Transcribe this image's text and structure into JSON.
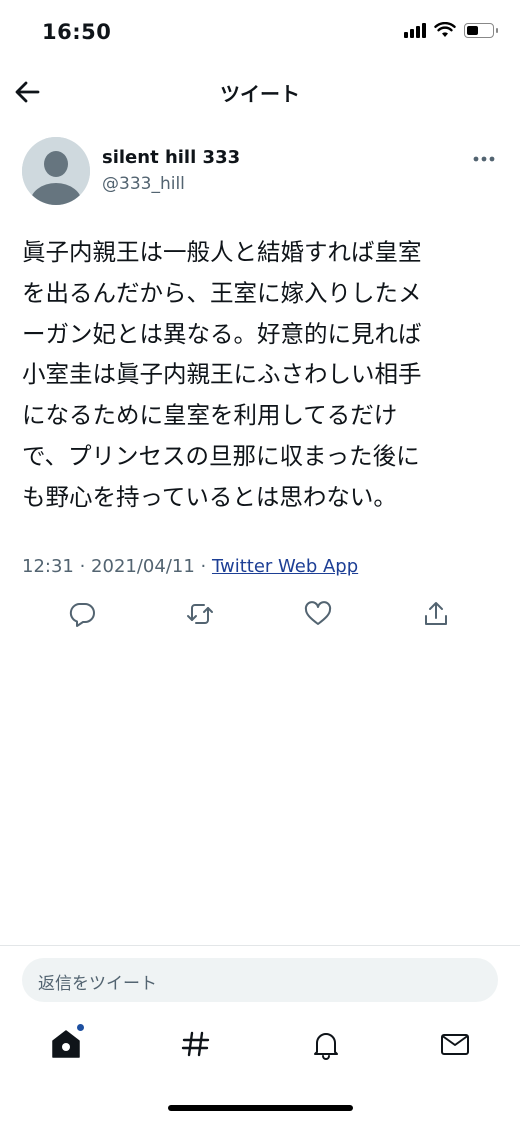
{
  "status_bar": {
    "time": "16:50"
  },
  "nav": {
    "title": "ツイート",
    "back_icon": "arrow-left-icon"
  },
  "tweet": {
    "display_name": "silent hill 333",
    "handle": "@333_hill",
    "text": "眞子内親王は一般人と結婚すれば皇室\nを出るんだから、王室に嫁入りしたメ\nーガン妃とは異なる。好意的に見れば\n小室圭は眞子内親王にふさわしい相手\nになるために皇室を利用してるだけ\nで、プリンセスの旦那に収まった後に\nも野心を持っているとは思わない。",
    "time": "12:31",
    "date": "2021/04/11",
    "separator": " · ",
    "source": "Twitter Web App"
  },
  "actions": [
    "reply-icon",
    "retweet-icon",
    "like-icon",
    "share-icon"
  ],
  "reply_placeholder": "返信をツイート",
  "tabbar": [
    "home-icon",
    "explore-hashtag-icon",
    "notifications-bell-icon",
    "messages-envelope-icon"
  ],
  "colors": {
    "text": "#0f1419",
    "secondary": "#536471",
    "link": "#1d3f95",
    "notification_dot": "#1d4fa0"
  }
}
